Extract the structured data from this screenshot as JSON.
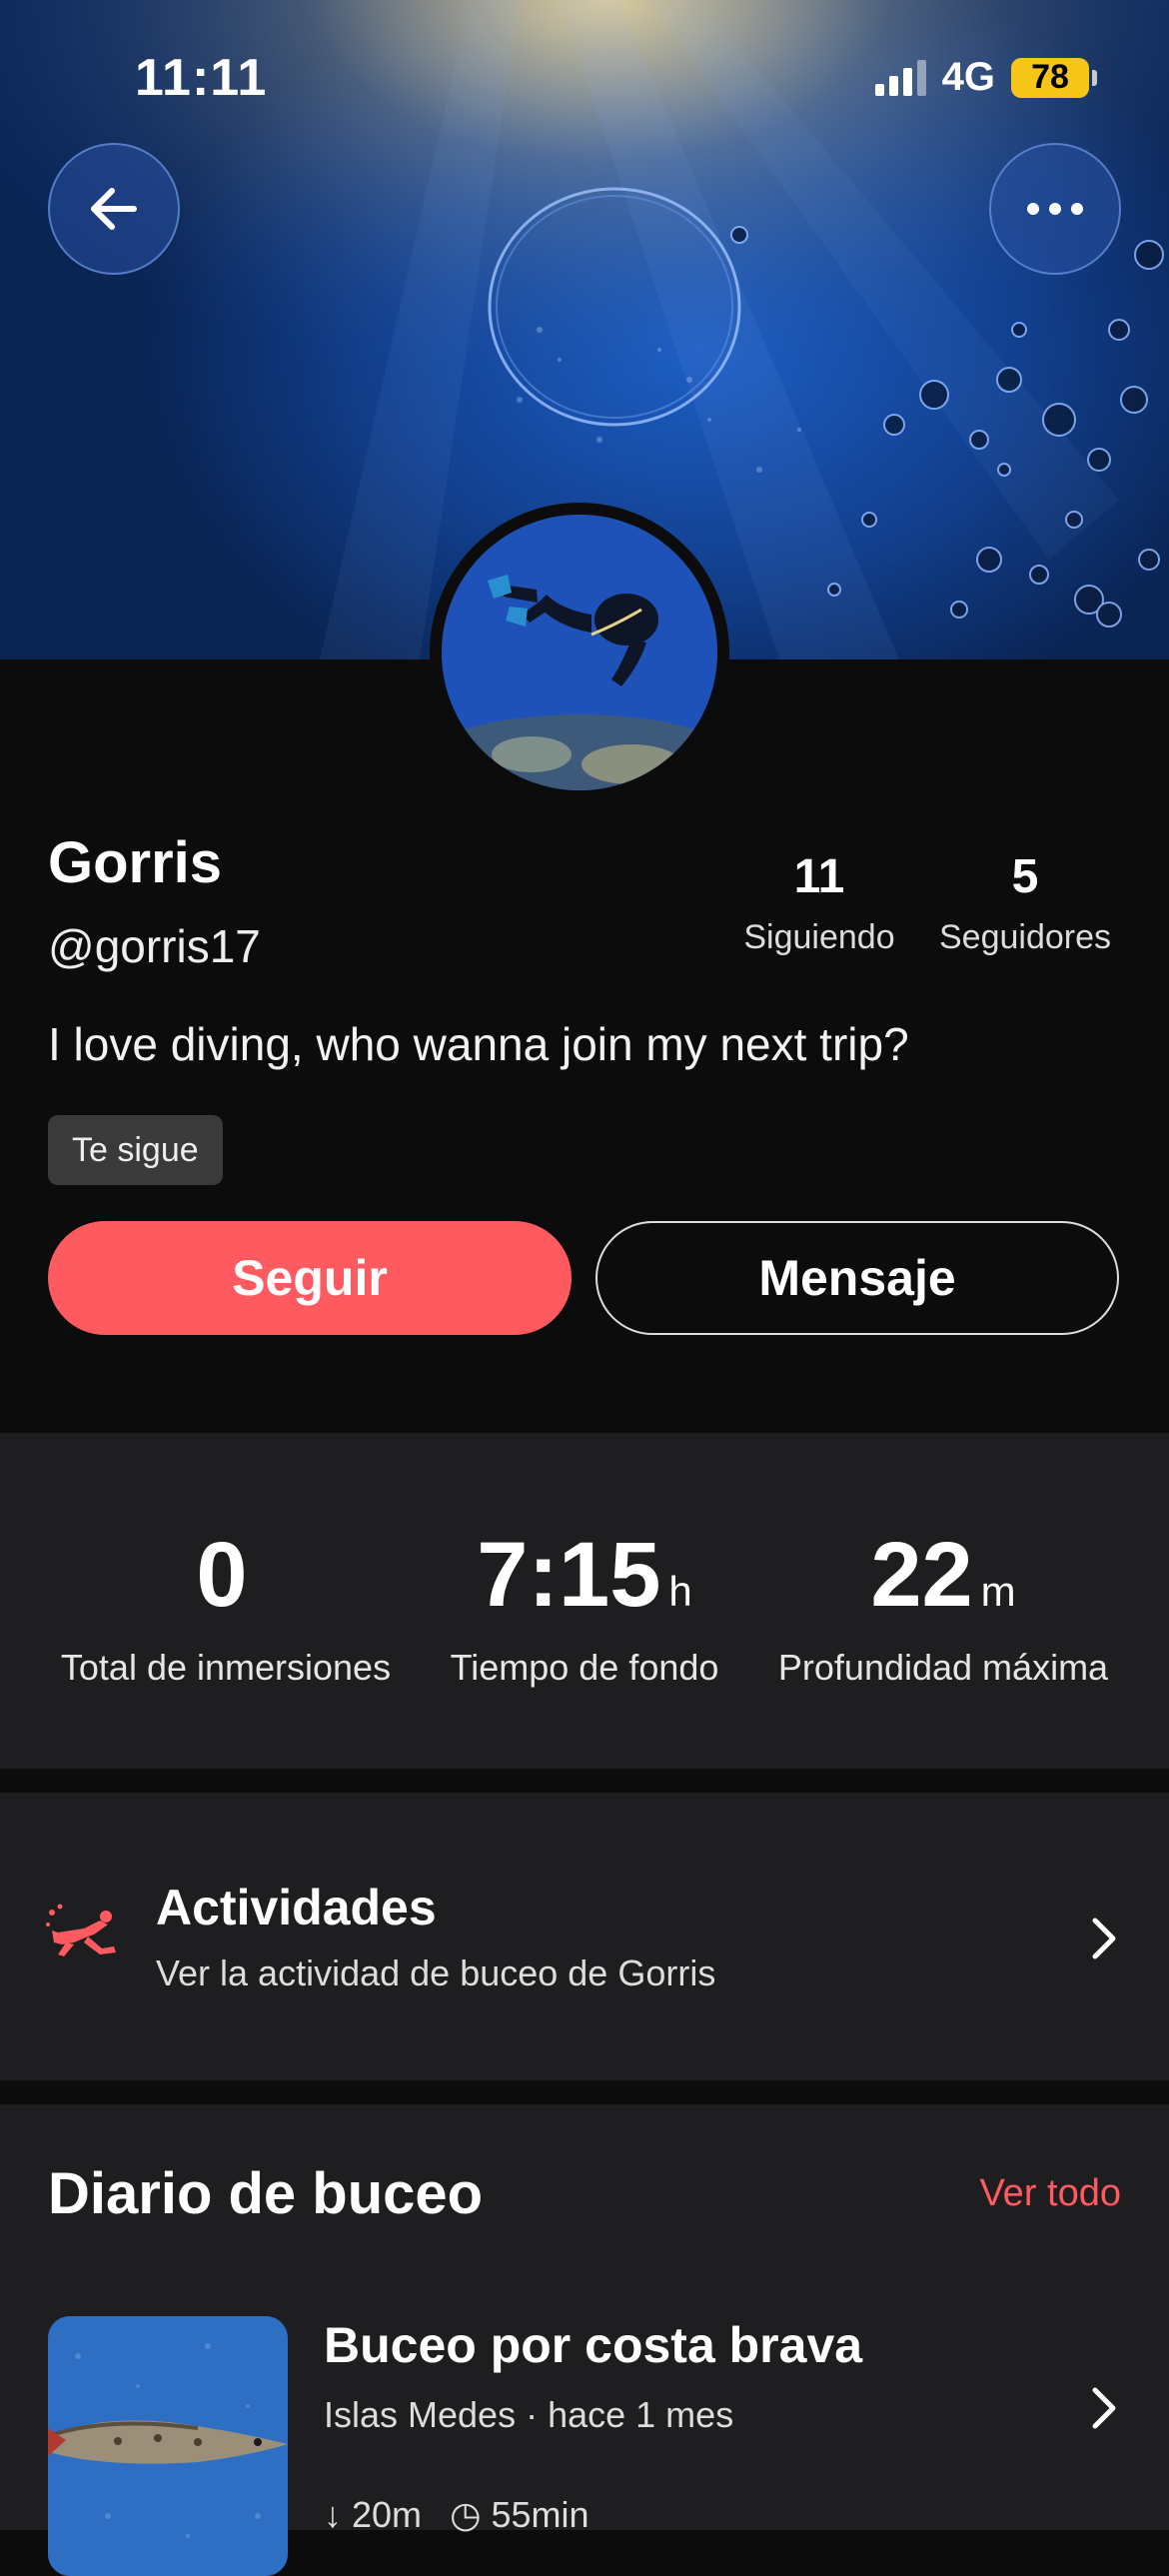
{
  "status_bar": {
    "time": "11:11",
    "network": "4G",
    "battery": "78"
  },
  "header": {
    "back_icon": "arrow-left-icon",
    "more_icon": "more-horizontal-icon"
  },
  "profile": {
    "name": "Gorris",
    "handle": "@gorris17",
    "following_count": "11",
    "following_label": "Siguiendo",
    "followers_count": "5",
    "followers_label": "Seguidores",
    "bio": "I love diving, who wanna join my next trip?",
    "follows_you_badge": "Te sigue",
    "follow_button": "Seguir",
    "message_button": "Mensaje"
  },
  "stats": [
    {
      "value": "0",
      "unit": "",
      "label": "Total de inmersiones"
    },
    {
      "value": "7:15",
      "unit": "h",
      "label": "Tiempo de fondo"
    },
    {
      "value": "22",
      "unit": "m",
      "label": "Profundidad máxima"
    }
  ],
  "activities": {
    "title": "Actividades",
    "subtitle": "Ver la actividad de buceo de Gorris",
    "icon": "diver-icon"
  },
  "diary": {
    "title": "Diario de buceo",
    "see_all": "Ver todo",
    "entries": [
      {
        "title": "Buceo por costa brava",
        "location": "Islas Medes",
        "time_ago": "hace 1 mes",
        "depth": "20m",
        "duration": "55min"
      }
    ]
  },
  "colors": {
    "accent": "#ff5a60",
    "panel": "#1e1e20",
    "background": "#0c0c0c",
    "battery": "#f5c518"
  }
}
